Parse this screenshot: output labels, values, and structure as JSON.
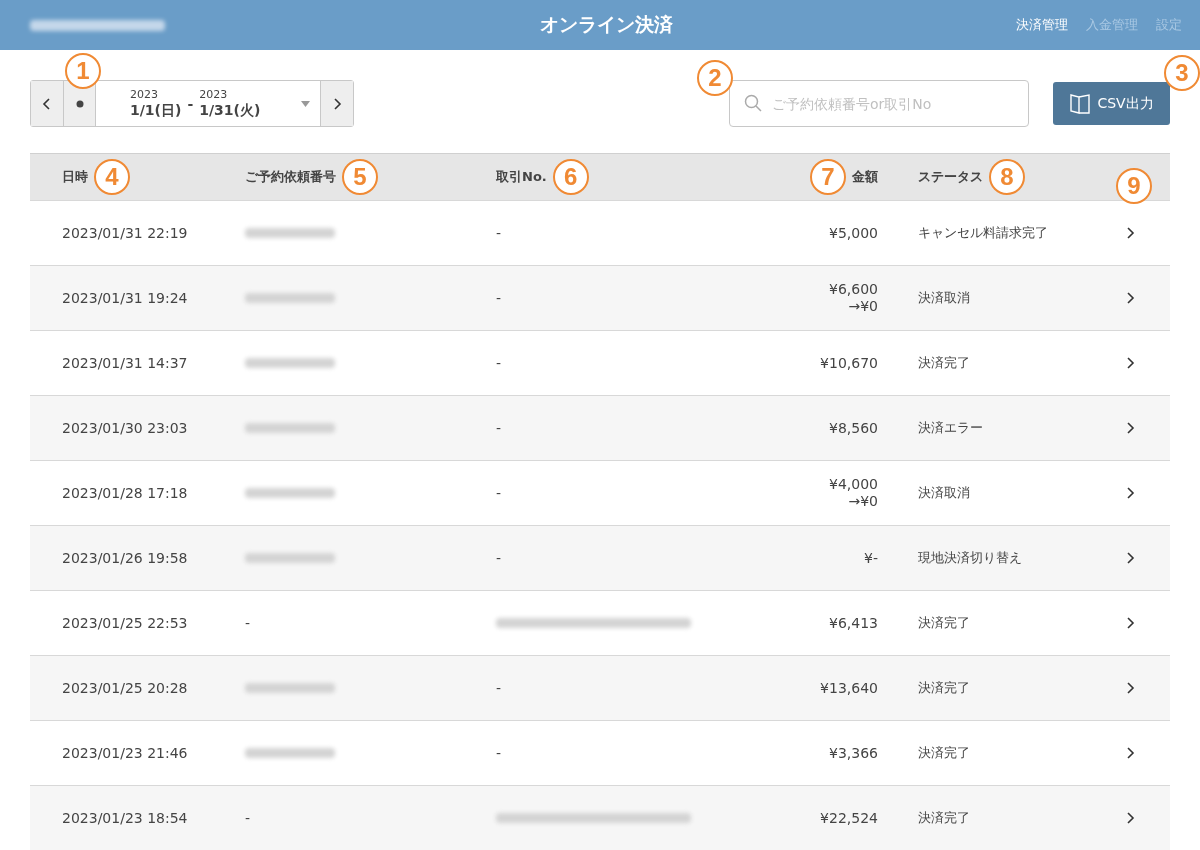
{
  "header": {
    "shop_name_redacted": true,
    "title": "オンライン決済",
    "nav": [
      {
        "label": "決済管理",
        "selected": true
      },
      {
        "label": "入金管理",
        "selected": false
      },
      {
        "label": "設定",
        "selected": false
      }
    ]
  },
  "date_range": {
    "start_year": "2023",
    "start": "1/1(日)",
    "separator": "-",
    "end_year": "2023",
    "end": "1/31(火)"
  },
  "search": {
    "placeholder": "ご予約依頼番号or取引No"
  },
  "export_button": {
    "label": "CSV出力"
  },
  "table": {
    "columns": [
      "日時",
      "ご予約依頼番号",
      "取引No.",
      "金額",
      "ステータス"
    ],
    "rows": [
      {
        "datetime": "2023/01/31 22:19",
        "request_no_redacted": true,
        "transaction_no": "-",
        "amount": "¥5,000",
        "status": "キャンセル料請求完了"
      },
      {
        "datetime": "2023/01/31 19:24",
        "request_no_redacted": true,
        "transaction_no": "-",
        "amount": "¥6,600",
        "amount_after": "→¥0",
        "status": "決済取消"
      },
      {
        "datetime": "2023/01/31 14:37",
        "request_no_redacted": true,
        "transaction_no": "-",
        "amount": "¥10,670",
        "status": "決済完了"
      },
      {
        "datetime": "2023/01/30 23:03",
        "request_no_redacted": true,
        "transaction_no": "-",
        "amount": "¥8,560",
        "status": "決済エラー"
      },
      {
        "datetime": "2023/01/28 17:18",
        "request_no_redacted": true,
        "transaction_no": "-",
        "amount": "¥4,000",
        "amount_after": "→¥0",
        "status": "決済取消"
      },
      {
        "datetime": "2023/01/26 19:58",
        "request_no_redacted": true,
        "transaction_no": "-",
        "amount": "¥-",
        "status": "現地決済切り替え"
      },
      {
        "datetime": "2023/01/25 22:53",
        "request_no": "-",
        "transaction_no_redacted": true,
        "amount": "¥6,413",
        "status": "決済完了"
      },
      {
        "datetime": "2023/01/25 20:28",
        "request_no_redacted": true,
        "transaction_no": "-",
        "amount": "¥13,640",
        "status": "決済完了"
      },
      {
        "datetime": "2023/01/23 21:46",
        "request_no_redacted": true,
        "transaction_no": "-",
        "amount": "¥3,366",
        "status": "決済完了"
      },
      {
        "datetime": "2023/01/23 18:54",
        "request_no": "-",
        "transaction_no_redacted": true,
        "amount": "¥22,524",
        "status": "決済完了"
      }
    ]
  },
  "annotations": [
    "1",
    "2",
    "3",
    "4",
    "5",
    "6",
    "7",
    "8",
    "9"
  ]
}
